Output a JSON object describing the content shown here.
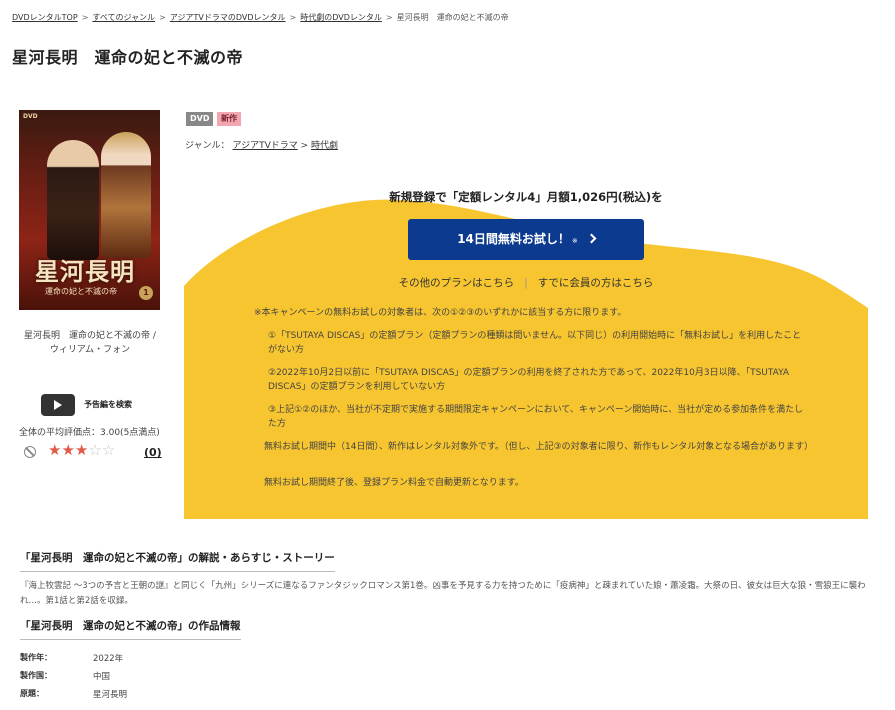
{
  "breadcrumb": {
    "items": [
      "DVDレンタルTOP",
      "すべてのジャンル",
      "アジアTVドラマのDVDレンタル",
      "時代劇のDVDレンタル"
    ],
    "current": "星河長明　運命の妃と不滅の帝",
    "separator": ">"
  },
  "title": "星河長明　運命の妃と不滅の帝",
  "cover": {
    "dvd_mark": "DVD",
    "title_text": "星河長明",
    "subtitle_text": "運命の妃と不滅の帝",
    "volume": "1"
  },
  "caption": {
    "line1": "星河長明　運命の妃と不滅の帝 /",
    "line2": "ウィリアム・フォン"
  },
  "trailer": {
    "label": "予告編を検索"
  },
  "rating": {
    "label": "全体の平均評価点：",
    "value": "3.00(5点満点)",
    "score": 3,
    "max": 5,
    "review_count": "(0)",
    "star_color": "#e05a4a"
  },
  "badges": {
    "dvd": "DVD",
    "new": "新作"
  },
  "genre": {
    "label": "ジャンル：",
    "items": [
      "アジアTVドラマ",
      "時代劇"
    ],
    "separator": ">"
  },
  "promo": {
    "headline": "新規登録で「定額レンタル4」月額1,026円(税込)を",
    "button_label": "14日間無料お試し！",
    "button_note": "※",
    "other_plans": "その他のプランはこちら",
    "members": "すでに会員の方はこちら",
    "divider": "|",
    "bg_color": "#f7c52f",
    "button_color": "#0b3a8e",
    "notes": [
      "※本キャンペーンの無料お試しの対象者は、次の①②③のいずれかに該当する方に限ります。",
      "①「TSUTAYA DISCAS」の定額プラン（定額プランの種類は問いません。以下同じ）の利用開始時に「無料お試し」を利用したことがない方",
      "②2022年10月2日以前に「TSUTAYA DISCAS」の定額プランの利用を終了された方であって、2022年10月3日以降、「TSUTAYA DISCAS」の定額プランを利用していない方",
      "③上記①②のほか、当社が不定期で実施する期間限定キャンペーンにおいて、キャンペーン開始時に、当社が定める参加条件を満たした方",
      "無料お試し期間中（14日間）、新作はレンタル対象外です。（但し、上記③の対象者に限り、新作もレンタル対象となる場合があります）",
      "無料お試し期間終了後、登録プラン料金で自動更新となります。"
    ]
  },
  "synopsis": {
    "heading": "「星河長明　運命の妃と不滅の帝」の解説・あらすじ・ストーリー",
    "text": "『海上牧雲記 〜3つの予言と王朝の謎』と同じく「九州」シリーズに連なるファンタジックロマンス第1巻。凶事を予見する力を持つために「疫病神」と疎まれていた娘・蕭凌霜。大祭の日、彼女は巨大な狼・雪狼王に襲われ…。第1話と第2話を収録。"
  },
  "work_info": {
    "heading": "「星河長明　運命の妃と不滅の帝」の作品情報",
    "rows": [
      {
        "label": "製作年：",
        "value": "2022年"
      },
      {
        "label": "製作国：",
        "value": "中国"
      },
      {
        "label": "原題：",
        "value": "星河長明"
      }
    ]
  }
}
